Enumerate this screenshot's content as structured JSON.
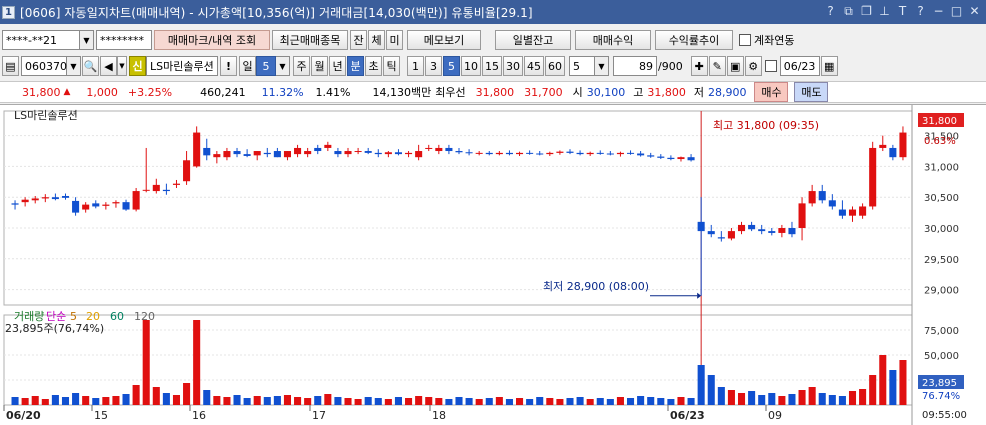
{
  "window": {
    "number": "1",
    "title": "[0606] 자동일지차트(매매내역) - 시가총액[10,356(억)] 거래대금[14,030(백만)] 유통비율[29.1]",
    "icons": [
      "help-icon",
      "restore-icon",
      "copy-icon",
      "pin-icon",
      "font-size-icon",
      "menu-icon",
      "minimize-icon",
      "maximize-icon",
      "close-icon"
    ]
  },
  "toolbar1": {
    "account": "****-**21",
    "password": "********",
    "trade_mark_label": "매매마크/내역 조회",
    "recent_label": "최근매매종목",
    "btn_jan": "잔",
    "btn_che": "체",
    "btn_mi": "미",
    "memo_label": "메모보기",
    "daily_balance_label": "일별잔고",
    "trade_profit_label": "매매수익",
    "profit_trend_label": "수익률추이",
    "account_link_label": "계좌연동"
  },
  "toolbar2": {
    "code": "060370",
    "credit_badge": "신",
    "stock_name": "LS마린솔루션",
    "period_il": "일",
    "period_value": "5",
    "periods": [
      "주",
      "월",
      "년",
      "분",
      "초",
      "틱"
    ],
    "selected_period": "분",
    "intervals": [
      "1",
      "3",
      "5",
      "10",
      "15",
      "30",
      "45",
      "60"
    ],
    "selected_interval": "5",
    "interval_input": "5",
    "count": "89",
    "count_total": "/900",
    "date": "06/23"
  },
  "quote": {
    "price": "31,800",
    "change": "1,000",
    "rate": "+3.25%",
    "volume": "460,241",
    "vol_ratio": "11.32%",
    "turnover": "1.41%",
    "amount": "14,130백만",
    "best_label": "최우선",
    "ask": "31,800",
    "bid": "31,700",
    "open_label": "시",
    "open": "30,100",
    "high_label": "고",
    "high": "31,800",
    "low_label": "저",
    "low": "28,900",
    "buy_label": "매수",
    "sell_label": "매도"
  },
  "chart": {
    "name_label": "LS마린솔루션",
    "high_annotation": "최고 31,800 (09:35)",
    "low_annotation": "최저 28,900 (08:00)",
    "price_tag": "31,800",
    "rate_tag": "0.63%",
    "volume_legend": [
      "거래량",
      "단순",
      "5",
      "20",
      "60",
      "120"
    ],
    "volume_text": "23,895주(76,74%)",
    "volume_tag": "23,895",
    "volume_rate_tag": "76.74%",
    "time_tag": "09:55:00"
  },
  "chart_data": {
    "type": "candlestick",
    "y_ticks": [
      "31,500",
      "31,000",
      "30,500",
      "30,000",
      "29,500",
      "29,000"
    ],
    "y_range": [
      28750,
      31900
    ],
    "vol_ticks": [
      "75,000",
      "50,000",
      "25,000"
    ],
    "x_labels": [
      "06/20",
      "15",
      "16",
      "17",
      "18",
      "06/23",
      "09"
    ],
    "candles": [
      [
        30400,
        30450,
        30300,
        30380
      ],
      [
        30420,
        30500,
        30350,
        30460
      ],
      [
        30450,
        30520,
        30400,
        30480
      ],
      [
        30480,
        30550,
        30420,
        30500
      ],
      [
        30500,
        30560,
        30450,
        30470
      ],
      [
        30520,
        30560,
        30460,
        30490
      ],
      [
        30440,
        30500,
        30200,
        30250
      ],
      [
        30300,
        30420,
        30250,
        30380
      ],
      [
        30400,
        30450,
        30320,
        30350
      ],
      [
        30360,
        30420,
        30300,
        30380
      ],
      [
        30400,
        30450,
        30330,
        30420
      ],
      [
        30420,
        30460,
        30280,
        30300
      ],
      [
        30300,
        30650,
        30270,
        30600
      ],
      [
        30620,
        31300,
        30580,
        30620
      ],
      [
        30600,
        30800,
        30560,
        30700
      ],
      [
        30620,
        30720,
        30540,
        30600
      ],
      [
        30700,
        30780,
        30650,
        30720
      ],
      [
        30760,
        31250,
        30700,
        31100
      ],
      [
        31000,
        31650,
        30980,
        31550
      ],
      [
        31300,
        31450,
        31100,
        31180
      ],
      [
        31150,
        31250,
        31050,
        31200
      ],
      [
        31150,
        31300,
        31100,
        31250
      ],
      [
        31250,
        31300,
        31150,
        31200
      ],
      [
        31200,
        31280,
        31150,
        31170
      ],
      [
        31180,
        31250,
        31100,
        31250
      ],
      [
        31220,
        31300,
        31150,
        31200
      ],
      [
        31250,
        31300,
        31150,
        31150
      ],
      [
        31150,
        31250,
        31100,
        31250
      ],
      [
        31200,
        31350,
        31150,
        31300
      ],
      [
        31200,
        31300,
        31150,
        31250
      ],
      [
        31300,
        31350,
        31200,
        31250
      ],
      [
        31300,
        31400,
        31250,
        31350
      ],
      [
        31250,
        31300,
        31150,
        31200
      ],
      [
        31200,
        31300,
        31150,
        31250
      ],
      [
        31250,
        31300,
        31200,
        31250
      ],
      [
        31250,
        31300,
        31200,
        31220
      ],
      [
        31220,
        31280,
        31150,
        31200
      ],
      [
        31200,
        31250,
        31150,
        31230
      ],
      [
        31230,
        31280,
        31180,
        31200
      ],
      [
        31200,
        31250,
        31150,
        31220
      ],
      [
        31150,
        31350,
        31100,
        31250
      ],
      [
        31300,
        31350,
        31250,
        31300
      ],
      [
        31250,
        31350,
        31200,
        31300
      ],
      [
        31300,
        31350,
        31200,
        31250
      ],
      [
        31250,
        31300,
        31200,
        31230
      ],
      [
        31230,
        31280,
        31180,
        31220
      ],
      [
        31220,
        31250,
        31180,
        31220
      ],
      [
        31220,
        31250,
        31180,
        31200
      ],
      [
        31200,
        31250,
        31180,
        31220
      ],
      [
        31220,
        31260,
        31180,
        31200
      ],
      [
        31200,
        31240,
        31170,
        31220
      ],
      [
        31220,
        31260,
        31190,
        31210
      ],
      [
        31210,
        31250,
        31180,
        31200
      ],
      [
        31200,
        31240,
        31170,
        31220
      ],
      [
        31220,
        31260,
        31190,
        31240
      ],
      [
        31240,
        31280,
        31200,
        31220
      ],
      [
        31220,
        31260,
        31180,
        31200
      ],
      [
        31200,
        31240,
        31170,
        31220
      ],
      [
        31220,
        31260,
        31190,
        31210
      ],
      [
        31210,
        31250,
        31180,
        31200
      ],
      [
        31200,
        31240,
        31160,
        31220
      ],
      [
        31220,
        31260,
        31190,
        31210
      ],
      [
        31210,
        31250,
        31160,
        31180
      ],
      [
        31180,
        31220,
        31140,
        31160
      ],
      [
        31160,
        31200,
        31120,
        31140
      ],
      [
        31140,
        31180,
        31100,
        31120
      ],
      [
        31120,
        31160,
        31080,
        31150
      ],
      [
        31150,
        31200,
        31080,
        31100
      ],
      [
        30100,
        30500,
        28900,
        29950
      ],
      [
        29950,
        30050,
        29850,
        29900
      ],
      [
        29850,
        29950,
        29780,
        29830
      ],
      [
        29830,
        30000,
        29800,
        29950
      ],
      [
        29950,
        30100,
        29900,
        30050
      ],
      [
        30050,
        30100,
        29950,
        29980
      ],
      [
        29980,
        30050,
        29900,
        29950
      ],
      [
        29950,
        30000,
        29880,
        29920
      ],
      [
        29920,
        30050,
        29850,
        30000
      ],
      [
        30000,
        30100,
        29850,
        29900
      ],
      [
        30000,
        30500,
        29800,
        30400
      ],
      [
        30400,
        30700,
        30350,
        30600
      ],
      [
        30600,
        30700,
        30400,
        30450
      ],
      [
        30450,
        30550,
        30300,
        30350
      ],
      [
        30300,
        30450,
        30150,
        30200
      ],
      [
        30200,
        30350,
        30100,
        30300
      ],
      [
        30200,
        30400,
        30150,
        30350
      ],
      [
        30350,
        31400,
        30300,
        31300
      ],
      [
        31300,
        31500,
        31250,
        31350
      ],
      [
        31300,
        31350,
        31100,
        31150
      ],
      [
        31150,
        31650,
        31100,
        31550
      ]
    ],
    "volumes": [
      8,
      7,
      9,
      6,
      10,
      8,
      12,
      9,
      7,
      8,
      9,
      11,
      20,
      85,
      18,
      12,
      10,
      22,
      85,
      15,
      9,
      8,
      10,
      7,
      9,
      8,
      9,
      10,
      8,
      7,
      9,
      11,
      8,
      7,
      6,
      8,
      7,
      6,
      8,
      7,
      9,
      8,
      7,
      6,
      8,
      7,
      6,
      7,
      8,
      6,
      7,
      6,
      8,
      7,
      6,
      7,
      8,
      6,
      7,
      6,
      8,
      7,
      9,
      8,
      7,
      6,
      8,
      7,
      40,
      30,
      18,
      15,
      12,
      14,
      10,
      12,
      9,
      11,
      15,
      18,
      12,
      10,
      9,
      14,
      16,
      30,
      50,
      35,
      45
    ]
  }
}
